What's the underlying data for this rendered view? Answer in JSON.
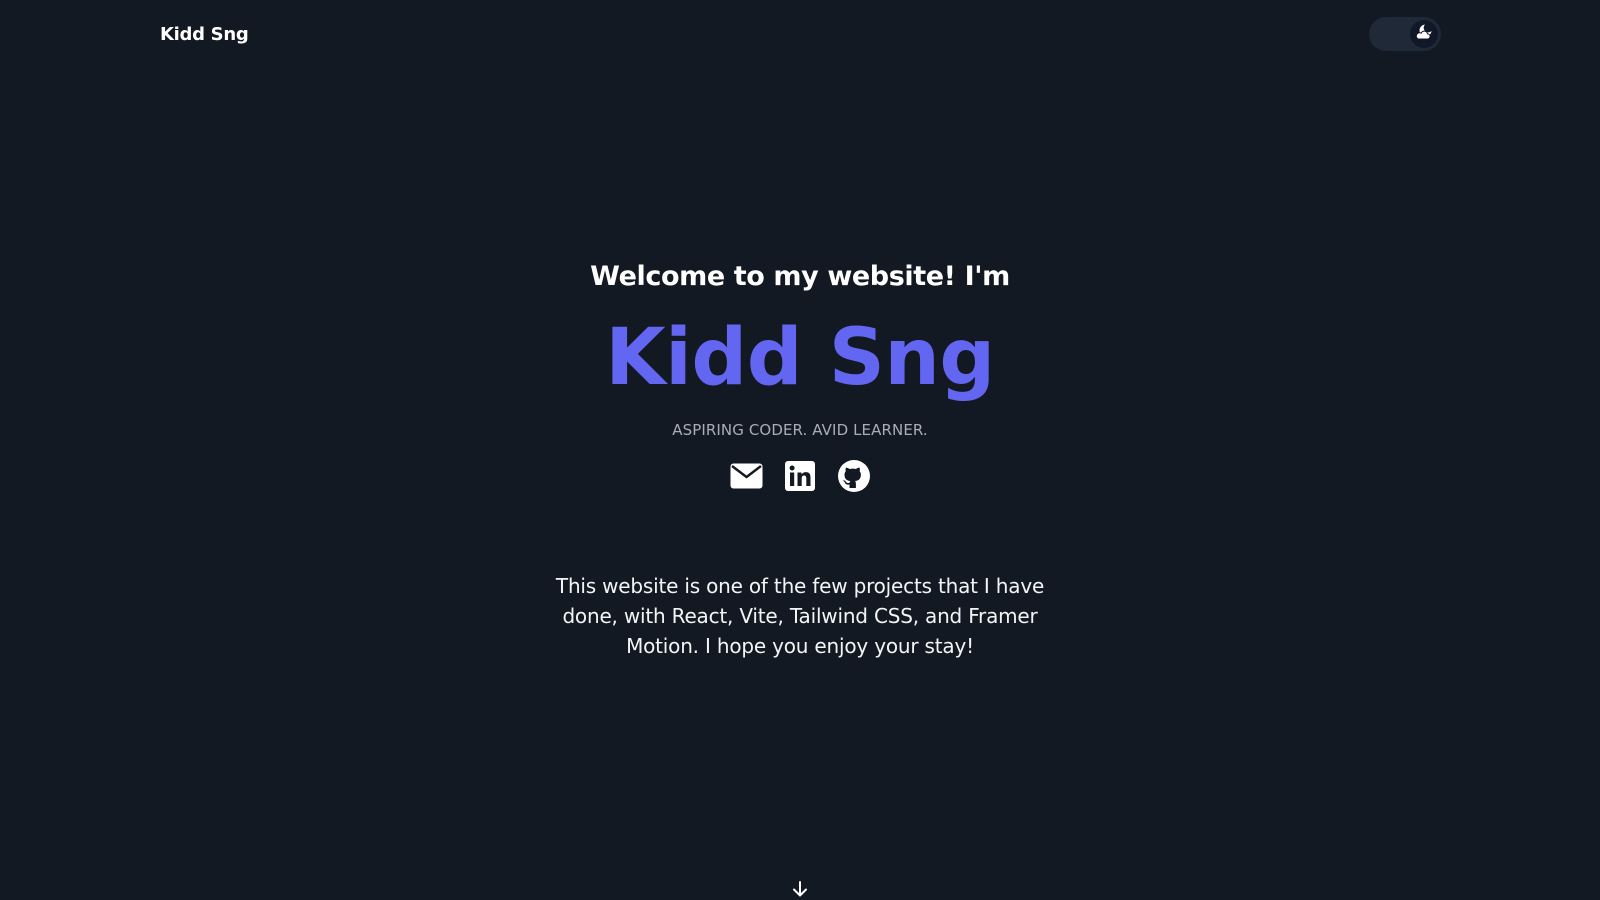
{
  "header": {
    "brand": "Kidd Sng",
    "theme_toggle_icon": "moon-cloud-icon"
  },
  "hero": {
    "welcome": "Welcome to my website! I'm",
    "name": "Kidd Sng",
    "tagline": "ASPIRING CODER. AVID LEARNER.",
    "socials": [
      {
        "icon": "envelope-icon"
      },
      {
        "icon": "linkedin-icon"
      },
      {
        "icon": "github-icon"
      }
    ]
  },
  "about": {
    "text": "This website is one of the few projects that I have done, with React, Vite, Tailwind CSS, and Framer Motion. I hope you enjoy your stay!"
  },
  "scroll": {
    "icon": "arrow-down-icon"
  },
  "colors": {
    "background": "#131922",
    "accent": "#6366f1",
    "tagline": "#a8adb7",
    "text": "#ffffff"
  }
}
